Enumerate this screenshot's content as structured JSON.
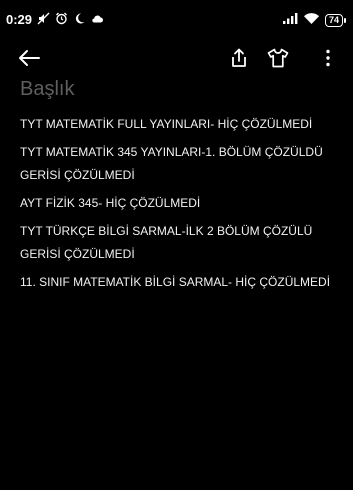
{
  "status_bar": {
    "time": "0:29",
    "battery": "74",
    "icons": [
      "sound-off-icon",
      "alarm-icon",
      "moon-icon",
      "cloud-icon",
      "signal-icon",
      "wifi-icon",
      "battery-icon"
    ]
  },
  "toolbar": {
    "icons": [
      "back-arrow-icon",
      "share-icon",
      "tshirt-icon",
      "more-vertical-icon"
    ]
  },
  "note": {
    "title_placeholder": "Başlık",
    "lines": [
      "TYT MATEMATİK FULL YAYINLARI-  HİÇ ÇÖZÜLMEDİ",
      "TYT MATEMATİK 345 YAYINLARI-1. BÖLÜM ÇÖZÜLDÜ GERİSİ ÇÖZÜLMEDİ",
      "AYT FİZİK 345- HİÇ ÇÖZÜLMEDİ",
      "TYT TÜRKÇE BİLGİ SARMAL-İLK 2 BÖLÜM ÇÖZÜLÜ GERİSİ ÇÖZÜLMEDİ",
      "11. SINIF MATEMATİK BİLGİ SARMAL- HİÇ ÇÖZÜLMEDİ"
    ]
  }
}
